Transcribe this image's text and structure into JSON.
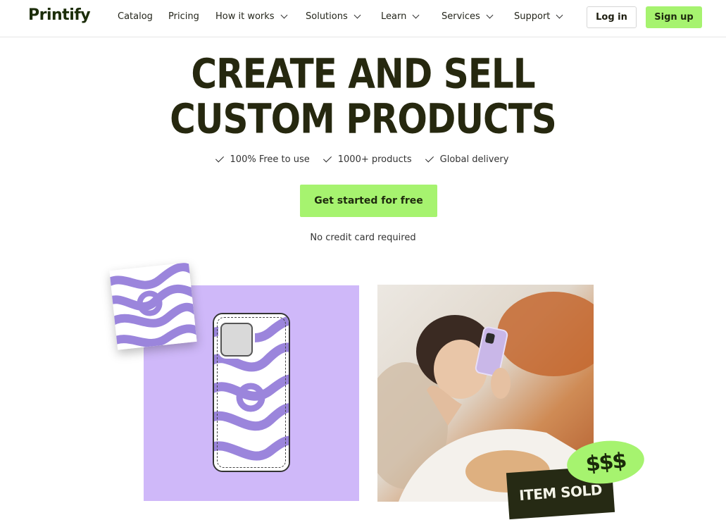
{
  "nav": {
    "logo": "Printify",
    "items": [
      {
        "label": "Catalog",
        "dropdown": false
      },
      {
        "label": "Pricing",
        "dropdown": false
      },
      {
        "label": "How it works",
        "dropdown": true
      },
      {
        "label": "Solutions",
        "dropdown": true
      },
      {
        "label": "Learn",
        "dropdown": true
      },
      {
        "label": "Services",
        "dropdown": true
      },
      {
        "label": "Support",
        "dropdown": true
      }
    ],
    "login_label": "Log in",
    "signup_label": "Sign up"
  },
  "hero": {
    "headline_line1": "CREATE AND SELL",
    "headline_line2": "CUSTOM PRODUCTS",
    "features": [
      "100% Free to use",
      "1000+ products",
      "Global delivery"
    ],
    "cta_label": "Get started for free",
    "note": "No credit card required"
  },
  "visuals": {
    "sticker_sold": "ITEM SOLD",
    "sticker_money": "$$$"
  },
  "colors": {
    "accent_green": "#a6f36f",
    "headline": "#26280f",
    "purple_panel": "#cfb8f9",
    "swirl_purple": "#9b85dc",
    "dark_badge": "#262a14"
  }
}
